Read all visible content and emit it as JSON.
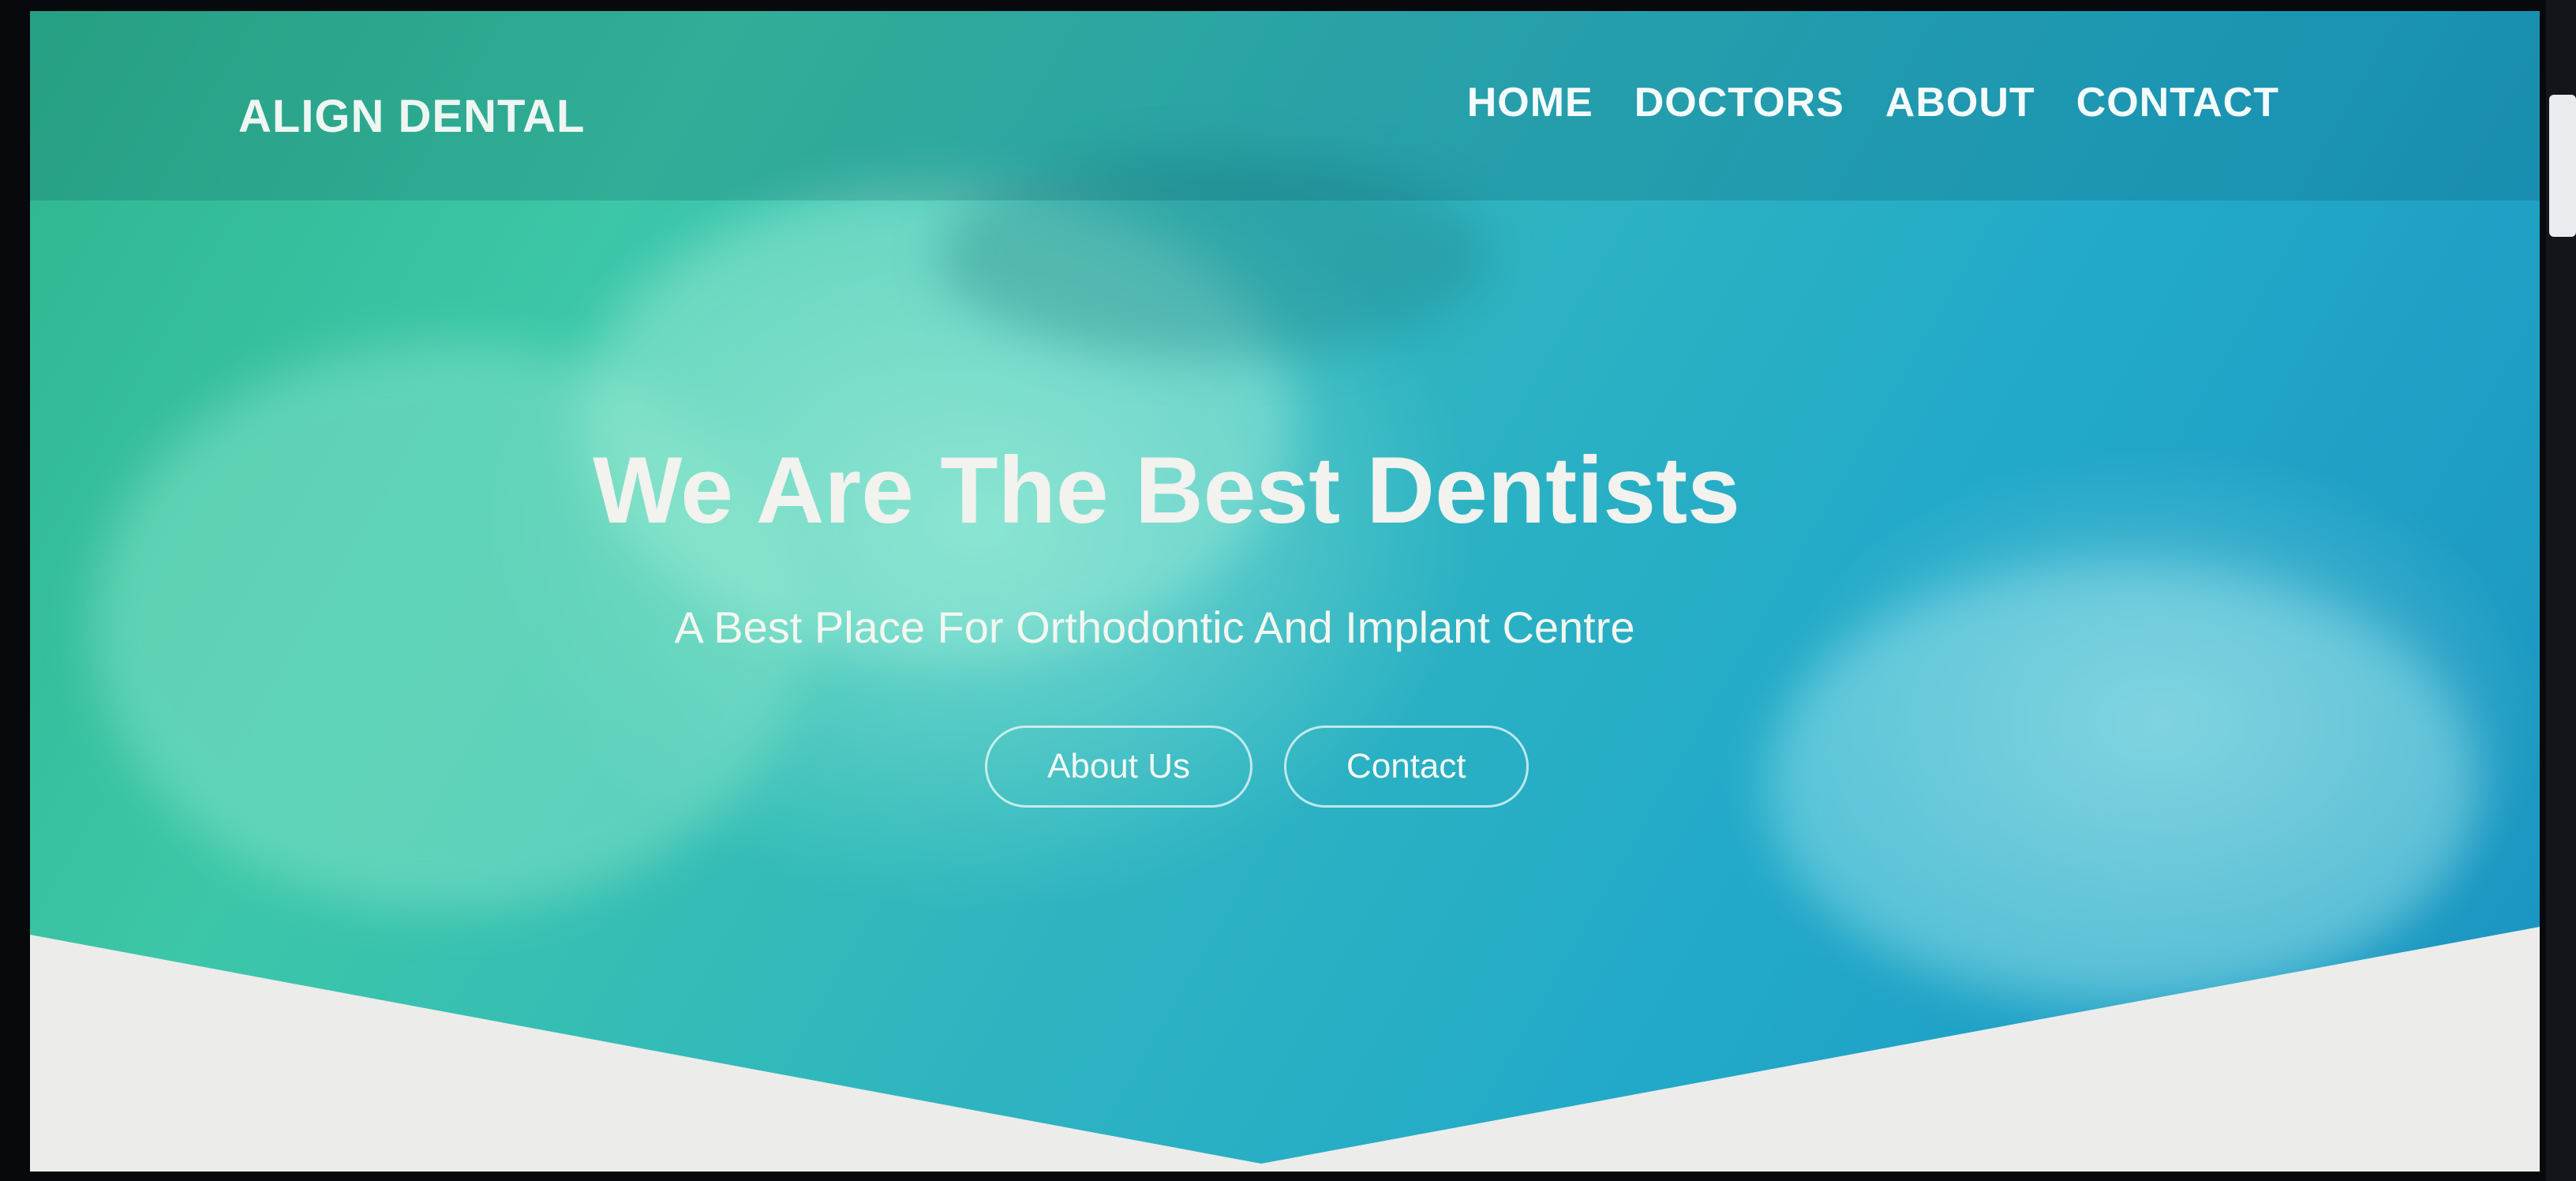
{
  "site": {
    "brand": "ALIGN DENTAL",
    "nav": [
      {
        "label": "HOME"
      },
      {
        "label": "DOCTORS"
      },
      {
        "label": "ABOUT"
      },
      {
        "label": "CONTACT"
      }
    ]
  },
  "hero": {
    "title": "We Are The Best Dentists",
    "subtitle": "A Best Place For Orthodontic And Implant Centre",
    "buttons": [
      {
        "label": "About Us"
      },
      {
        "label": "Contact"
      }
    ]
  },
  "colors": {
    "overlay_start": "#2fb58f",
    "overlay_end": "#1a93c0",
    "text": "#f2f2ee",
    "chevron_fill": "#ececea"
  }
}
